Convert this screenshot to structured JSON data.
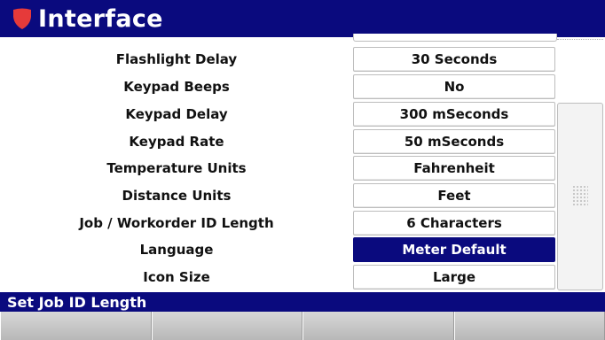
{
  "header": {
    "title": "Interface",
    "icon": "shield-icon",
    "accent": "#0a0a7e",
    "icon_color": "#e63a3a"
  },
  "settings": [
    {
      "label": "Flashlight Delay",
      "value": "30 Seconds",
      "selected": false
    },
    {
      "label": "Keypad Beeps",
      "value": "No",
      "selected": false
    },
    {
      "label": "Keypad Delay",
      "value": "300 mSeconds",
      "selected": false
    },
    {
      "label": "Keypad Rate",
      "value": "50 mSeconds",
      "selected": false
    },
    {
      "label": "Temperature Units",
      "value": "Fahrenheit",
      "selected": false
    },
    {
      "label": "Distance Units",
      "value": "Feet",
      "selected": false
    },
    {
      "label": "Job / Workorder ID Length",
      "value": "6 Characters",
      "selected": false
    },
    {
      "label": "Language",
      "value": "Meter Default",
      "selected": true
    },
    {
      "label": "Icon Size",
      "value": "Large",
      "selected": false
    }
  ],
  "status": {
    "text": "Set Job ID Length"
  },
  "softkeys": [
    "",
    "",
    "",
    ""
  ]
}
